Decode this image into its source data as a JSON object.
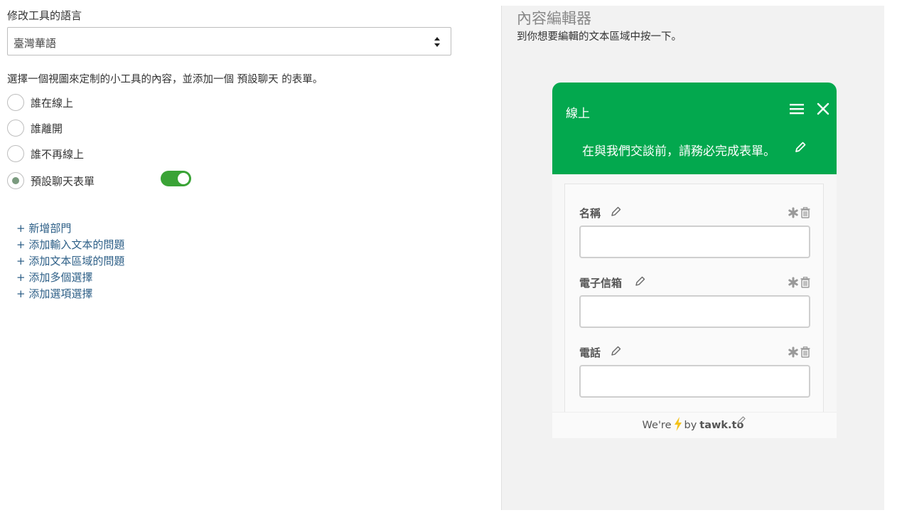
{
  "language": {
    "label": "修改工具的語言",
    "selected": "臺灣華語"
  },
  "view_selection": {
    "description": "選擇一個視圖來定制的小工具的內容，並添加一個 預設聊天 的表單。",
    "options": [
      {
        "label": "誰在線上",
        "checked": false
      },
      {
        "label": "誰離開",
        "checked": false
      },
      {
        "label": "誰不再線上",
        "checked": false
      },
      {
        "label": "預設聊天表單",
        "checked": true
      }
    ],
    "toggle_on": true
  },
  "add_links": [
    "+ 新增部門",
    "+ 添加輸入文本的問題",
    "+ 添加文本區域的問題",
    "+ 添加多個選擇",
    "+ 添加選項選擇"
  ],
  "editor": {
    "title": "內容編輯器",
    "description": "到你想要編輯的文本區域中按一下。"
  },
  "widget": {
    "status": "線上",
    "message": "在與我們交談前，請務必完成表單。",
    "fields": [
      {
        "label": "名稱"
      },
      {
        "label": "電子信箱"
      },
      {
        "label": "電話"
      }
    ],
    "footer": {
      "prefix": "We're",
      "by": "by",
      "brand": "tawk.to"
    }
  },
  "colors": {
    "widget_header": "#03a84e",
    "toggle": "#3aa336",
    "link": "#2d5f87"
  }
}
